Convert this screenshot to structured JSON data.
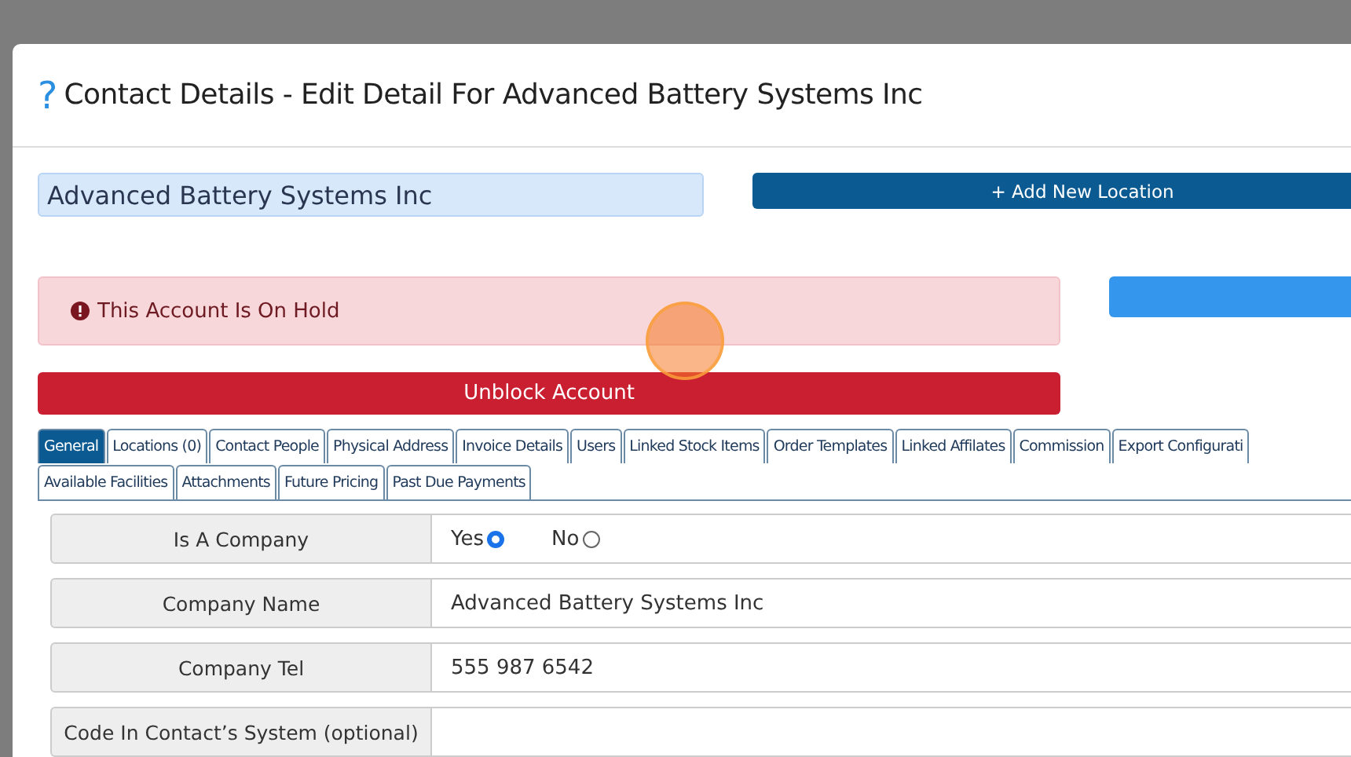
{
  "modal": {
    "help_icon": "?",
    "title": "Contact Details - Edit Detail For Advanced Battery Systems Inc"
  },
  "account_name": {
    "value": "Advanced Battery Systems Inc"
  },
  "add_location_button": "+ Add New Location",
  "alert": {
    "message": "This Account Is On Hold"
  },
  "unblock_button": "Unblock Account",
  "tab_rows": [
    [
      {
        "label": "General",
        "selected": true
      },
      {
        "label": "Locations (0)",
        "selected": false
      },
      {
        "label": "Contact People",
        "selected": false
      },
      {
        "label": "Physical Address",
        "selected": false
      },
      {
        "label": "Invoice Details",
        "selected": false
      },
      {
        "label": "Users",
        "selected": false
      },
      {
        "label": "Linked Stock Items",
        "selected": false
      },
      {
        "label": "Order Templates",
        "selected": false
      },
      {
        "label": "Linked Affilates",
        "selected": false
      },
      {
        "label": "Commission",
        "selected": false
      },
      {
        "label": "Export Configurati",
        "selected": false
      }
    ],
    [
      {
        "label": "Available Facilities",
        "selected": false
      },
      {
        "label": "Attachments",
        "selected": false
      },
      {
        "label": "Future Pricing",
        "selected": false
      },
      {
        "label": "Past Due Payments",
        "selected": false
      }
    ]
  ],
  "form_rows": [
    {
      "kind": "radio",
      "label": "Is A Company",
      "options": [
        {
          "label": "Yes",
          "selected": true
        },
        {
          "label": "No",
          "selected": false
        }
      ]
    },
    {
      "kind": "text",
      "label": "Company Name",
      "value": "Advanced Battery Systems Inc"
    },
    {
      "kind": "text",
      "label": "Company Tel",
      "value": "555 987 6542"
    },
    {
      "kind": "text",
      "label": "Code In Contact’s System (optional)",
      "value": ""
    }
  ]
}
